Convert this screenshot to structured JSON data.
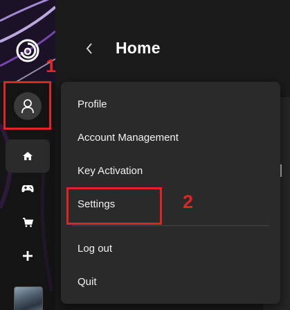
{
  "header": {
    "title": "Home"
  },
  "menu": {
    "items": [
      {
        "label": "Profile"
      },
      {
        "label": "Account Management"
      },
      {
        "label": "Key Activation"
      },
      {
        "label": "Settings"
      },
      {
        "label": "Log out"
      },
      {
        "label": "Quit"
      }
    ]
  },
  "annotations": {
    "step1": "1",
    "step2": "2"
  },
  "icons": {
    "logo": "ubisoft-swirl-icon",
    "avatar": "user-icon",
    "home": "home-icon",
    "games": "gamepad-icon",
    "store": "cart-icon",
    "add": "plus-icon",
    "back": "chevron-left-icon"
  },
  "colors": {
    "annotation": "#e02424",
    "menu_bg": "#2a2a2a",
    "sidebar_bg": "#141414"
  }
}
